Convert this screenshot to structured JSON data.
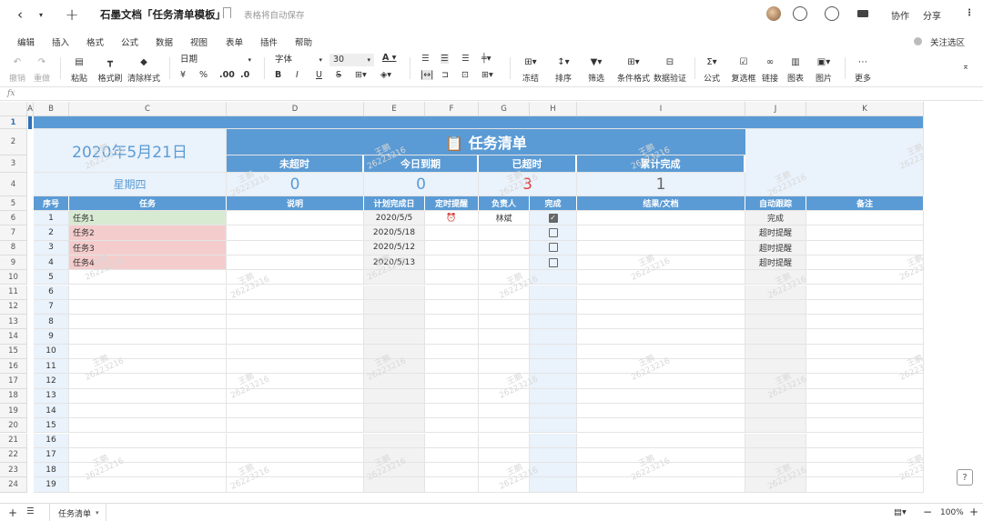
{
  "titlebar": {
    "doc_title": "石墨文档「任务清单模板」",
    "save_status": "表格将自动保存",
    "collab_label": "协作",
    "share_label": "分享"
  },
  "menu": [
    "编辑",
    "插入",
    "格式",
    "公式",
    "数据",
    "视图",
    "表单",
    "插件",
    "帮助"
  ],
  "menu_right": "关注选区",
  "toolbar": {
    "undo": "撤销",
    "redo": "重做",
    "paste": "粘贴",
    "format_painter": "格式刷",
    "clear_format": "清除样式",
    "number_format": "日期",
    "currency": "¥",
    "percent": "%",
    "dec_inc": ".00",
    "dec_dec": ".0",
    "font_family": "字体",
    "font_size": "30",
    "bold": "B",
    "italic": "I",
    "underline": "U",
    "strike": "S",
    "freeze": "冻结",
    "sort": "排序",
    "filter": "筛选",
    "cond_format": "条件格式",
    "validation": "数据验证",
    "formula": "公式",
    "checkbox": "复选框",
    "link": "链接",
    "chart": "图表",
    "image": "图片",
    "more": "更多"
  },
  "formula_bar": {
    "fx": "fx"
  },
  "columns": [
    "A",
    "B",
    "C",
    "D",
    "E",
    "F",
    "G",
    "H",
    "I",
    "J",
    "K"
  ],
  "rows": [
    "1",
    "2",
    "3",
    "4",
    "5",
    "6",
    "7",
    "8",
    "9",
    "10",
    "11",
    "12",
    "13",
    "14",
    "15",
    "16",
    "17",
    "18",
    "19",
    "20",
    "21",
    "22",
    "23",
    "24"
  ],
  "sheet": {
    "title": "📋 任务清单",
    "date": "2020年5月21日",
    "weekday": "星期四",
    "stats": [
      {
        "label": "未超时",
        "value": "0",
        "color": "#5b9bd5"
      },
      {
        "label": "今日到期",
        "value": "0",
        "color": "#5b9bd5"
      },
      {
        "label": "已超时",
        "value": "3",
        "color": "#e03c3c"
      },
      {
        "label": "累计完成",
        "value": "1",
        "color": "#666666"
      }
    ],
    "headers": [
      "序号",
      "任务",
      "说明",
      "计划完成日",
      "定时提醒",
      "负责人",
      "完成",
      "结果/文档",
      "自动跟踪",
      "备注"
    ],
    "tasks": [
      {
        "seq": "1",
        "name": "任务1",
        "date": "2020/5/5",
        "reminder": "alarm-icon",
        "owner": "林斌",
        "done": true,
        "track": "完成",
        "bg": "#d9ead3"
      },
      {
        "seq": "2",
        "name": "任务2",
        "date": "2020/5/18",
        "reminder": "",
        "owner": "",
        "done": false,
        "track": "超时提醒",
        "bg": "#f4cccc"
      },
      {
        "seq": "3",
        "name": "任务3",
        "date": "2020/5/12",
        "reminder": "",
        "owner": "",
        "done": false,
        "track": "超时提醒",
        "bg": "#f4cccc"
      },
      {
        "seq": "4",
        "name": "任务4",
        "date": "2020/5/13",
        "reminder": "",
        "owner": "",
        "done": false,
        "track": "超时提醒",
        "bg": "#f4cccc"
      }
    ],
    "empty_seq": [
      "5",
      "6",
      "7",
      "8",
      "9",
      "10",
      "11",
      "12",
      "13",
      "14",
      "15",
      "16",
      "17",
      "18",
      "19"
    ],
    "watermark": [
      "王鹏",
      "26223216"
    ]
  },
  "bottom": {
    "sheet_tab": "任务清单",
    "zoom": "100%"
  }
}
